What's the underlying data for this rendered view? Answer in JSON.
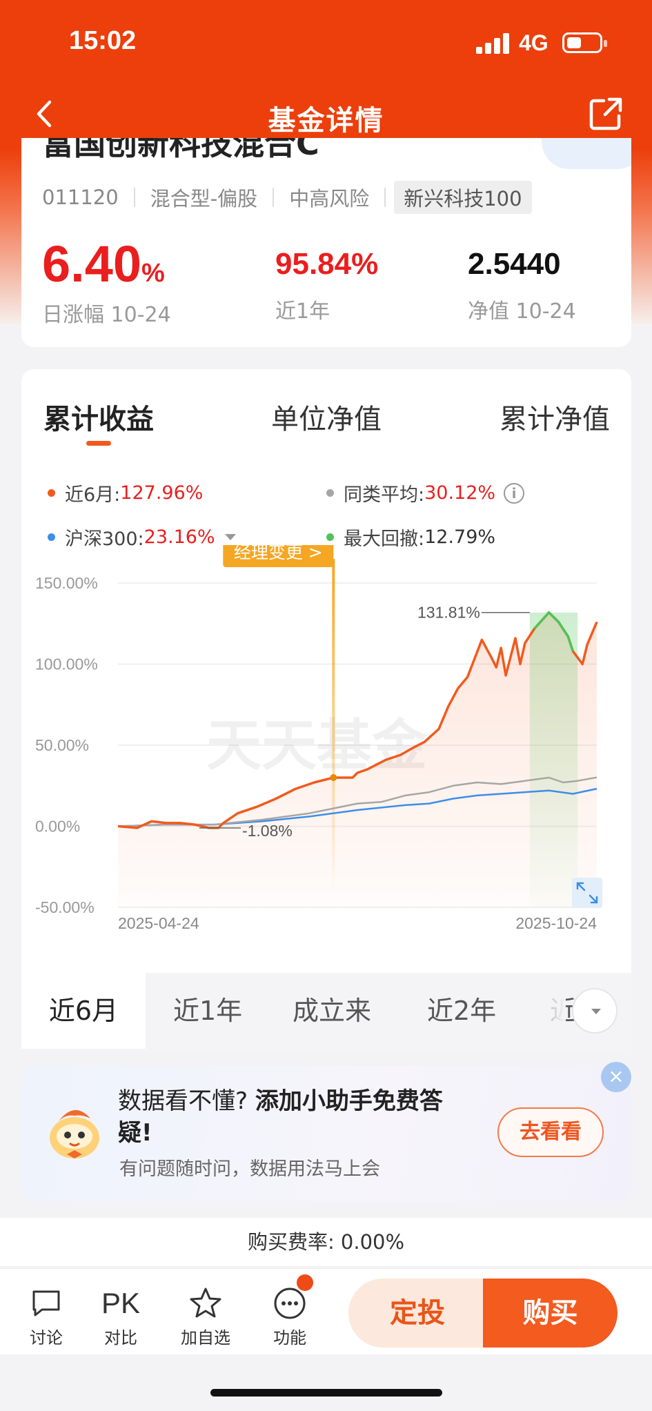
{
  "status_bar": {
    "time": "15:02",
    "network": "4G"
  },
  "nav": {
    "title": "基金详情"
  },
  "fund": {
    "name": "富国创新科技混合C",
    "code": "011120",
    "type": "混合型-偏股",
    "risk": "中高风险",
    "tag": "新兴科技100",
    "daily_change": {
      "value": "6.40",
      "unit": "%",
      "label": "日涨幅 10-24"
    },
    "one_year": {
      "value": "95.84%",
      "label": "近1年"
    },
    "nav": {
      "value": "2.5440",
      "label": "净值 10-24"
    }
  },
  "chart_tabs": [
    "累计收益",
    "单位净值",
    "累计净值"
  ],
  "legend": {
    "fund": {
      "label": "近6月:",
      "value": "127.96%"
    },
    "category_avg": {
      "label": "同类平均:",
      "value": "30.12%"
    },
    "index": {
      "label": "沪深300:",
      "value": "23.16%"
    },
    "max_drawdown": {
      "label": "最大回撤:",
      "value": "12.79%"
    }
  },
  "chart_labels": {
    "manager_change": "经理变更 >",
    "peak": "131.81%",
    "trough": "-1.08%",
    "watermark": "天天基金",
    "x_start": "2025-04-24",
    "x_end": "2025-10-24"
  },
  "colors": {
    "accent": "#ee4b16",
    "fund": "#f15a1d",
    "avg": "#a6a6a6",
    "index": "#3d8de9",
    "drawdown": "#52c25a",
    "red": "#ea1e1e"
  },
  "chart_data": {
    "type": "line",
    "x_range": [
      "2025-04-24",
      "2025-10-24"
    ],
    "y_ticks": [
      "150.00%",
      "100.00%",
      "50.00%",
      "0.00%",
      "-50.00%"
    ],
    "ylim": [
      -50,
      150
    ],
    "series": [
      {
        "name": "近6月",
        "x": [
          0,
          0.04,
          0.07,
          0.1,
          0.13,
          0.16,
          0.19,
          0.21,
          0.22,
          0.25,
          0.29,
          0.33,
          0.37,
          0.41,
          0.45,
          0.49,
          0.5,
          0.52,
          0.56,
          0.59,
          0.62,
          0.64,
          0.67,
          0.69,
          0.71,
          0.73,
          0.76,
          0.78,
          0.79,
          0.8,
          0.81,
          0.83,
          0.84,
          0.85,
          0.87,
          0.9,
          0.92,
          0.94,
          0.95,
          0.97,
          0.98,
          1
        ],
        "values": [
          0,
          -1,
          3,
          2,
          2,
          1,
          -1,
          -1,
          2,
          8,
          12,
          17,
          23,
          27,
          30,
          30,
          33,
          35,
          41,
          44,
          49,
          52,
          60,
          74,
          85,
          92,
          115,
          104,
          98,
          110,
          93,
          116,
          100,
          113,
          122,
          131.81,
          126,
          117,
          108,
          100,
          112,
          126
        ]
      },
      {
        "name": "同类平均",
        "x": [
          0,
          0.1,
          0.2,
          0.3,
          0.4,
          0.45,
          0.5,
          0.55,
          0.6,
          0.65,
          0.7,
          0.75,
          0.8,
          0.85,
          0.9,
          0.93,
          0.96,
          1
        ],
        "values": [
          0,
          1,
          1,
          4,
          8,
          11,
          14,
          15,
          19,
          21,
          25,
          27,
          26,
          28,
          30,
          27,
          28,
          30.12
        ]
      },
      {
        "name": "沪深300",
        "x": [
          0,
          0.1,
          0.2,
          0.3,
          0.4,
          0.5,
          0.6,
          0.65,
          0.7,
          0.75,
          0.8,
          0.85,
          0.9,
          0.95,
          1
        ],
        "values": [
          0,
          1,
          1,
          3,
          6,
          10,
          13,
          14,
          17,
          19,
          20,
          21,
          22,
          20,
          23.16
        ]
      }
    ],
    "manager_change_x": 0.45,
    "drawdown_range_x": [
      0.86,
      0.96
    ],
    "peak": {
      "x": 0.86,
      "y": 131.81
    },
    "trough": {
      "x": 0.17,
      "y": -1.08
    }
  },
  "periods": [
    "近6月",
    "近1年",
    "成立来",
    "近2年",
    "近"
  ],
  "promo": {
    "title_plain": "数据看不懂?",
    "title_bold": "添加小助手免费答疑!",
    "subtitle": "有问题随时问，数据用法马上会",
    "button": "去看看"
  },
  "fee": "购买费率: 0.00%",
  "bottom_bar": {
    "discuss": "讨论",
    "compare": "对比",
    "compare_icon": "PK",
    "watch": "加自选",
    "functions": "功能",
    "sip": "定投",
    "buy": "购买"
  }
}
